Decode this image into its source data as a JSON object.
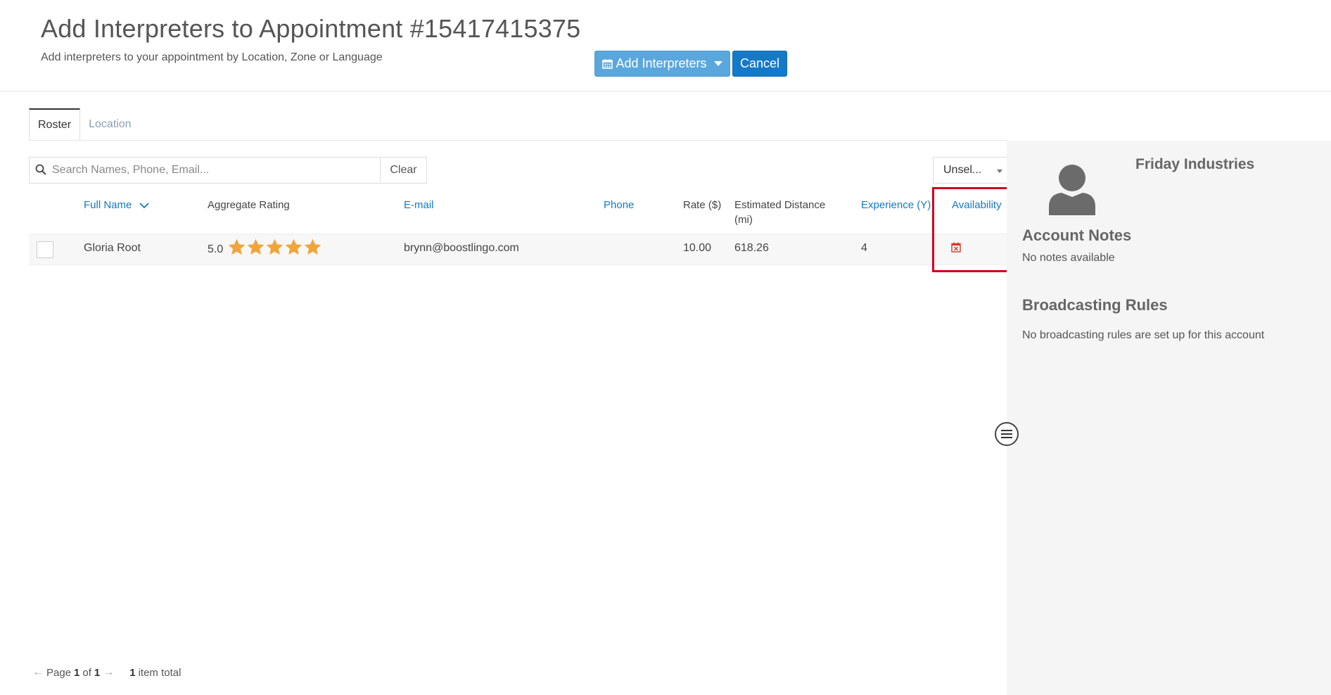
{
  "header": {
    "title": "Add Interpreters to Appointment #15417415375",
    "subtitle": "Add interpreters to your appointment by Location, Zone or Language",
    "add_interpreters_label": "Add Interpreters",
    "cancel_label": "Cancel"
  },
  "tabs": [
    {
      "label": "Roster",
      "active": true
    },
    {
      "label": "Location",
      "active": false
    }
  ],
  "search": {
    "placeholder": "Search Names, Phone, Email...",
    "value": "",
    "clear_label": "Clear"
  },
  "filter_select": {
    "value": "Unsel..."
  },
  "table": {
    "headers": {
      "full_name": "Full Name",
      "aggregate_rating": "Aggregate Rating",
      "email": "E-mail",
      "phone": "Phone",
      "rate": "Rate ($)",
      "distance_line1": "Estimated Distance",
      "distance_line2": "(mi)",
      "experience": "Experience (Y)",
      "availability": "Availability"
    },
    "rows": [
      {
        "full_name": "Gloria Root",
        "rating": "5.0",
        "stars": 5,
        "email": "brynn@boostlingo.com",
        "phone": "",
        "rate": "10.00",
        "distance": "618.26",
        "experience": "4",
        "availability_icon": "calendar-unavailable-icon"
      }
    ]
  },
  "pager": {
    "page_label": "Page",
    "current_page": "1",
    "of_label": "of",
    "total_pages": "1",
    "total_count": "1",
    "total_label": "item total"
  },
  "side_panel": {
    "company_name": "Friday Industries",
    "account_notes_title": "Account Notes",
    "account_notes_text": "No notes available",
    "broadcasting_rules_title": "Broadcasting Rules",
    "broadcasting_rules_text": "No broadcasting rules are set up for this account"
  },
  "colors": {
    "primary": "#1479c9",
    "primary_light": "#5aa7dd",
    "star": "#f0a43a",
    "highlight": "#d0021b",
    "availability_icon": "#d9362b"
  }
}
